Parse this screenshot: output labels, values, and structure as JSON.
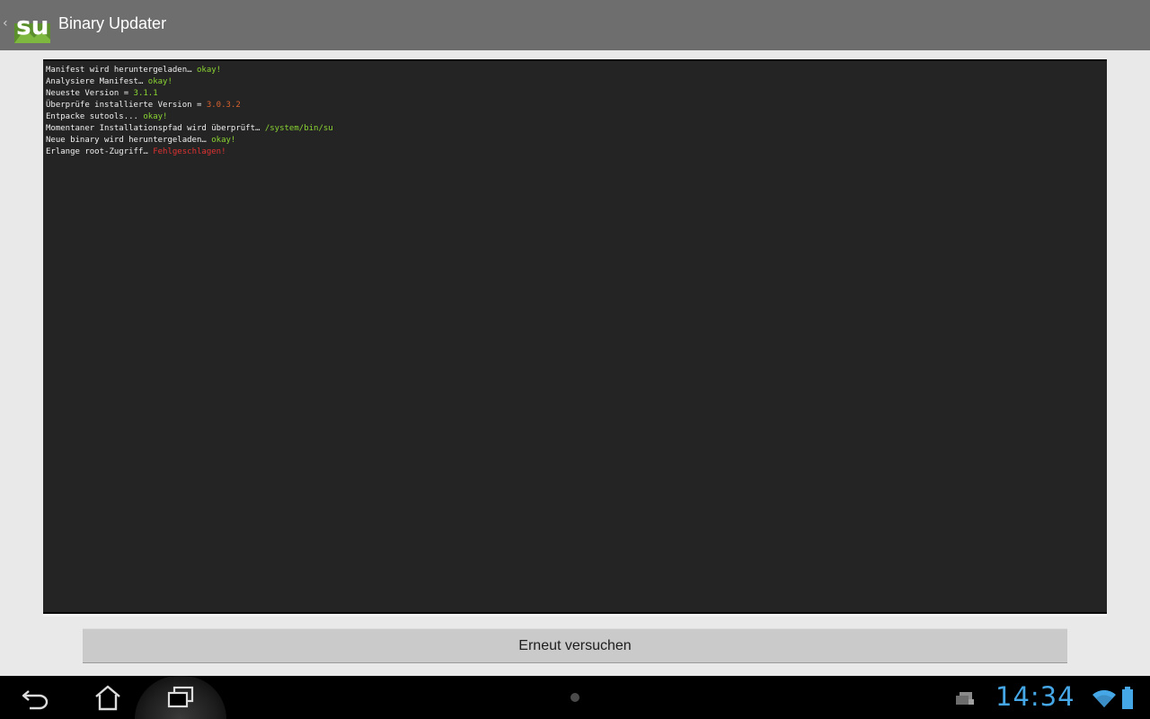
{
  "action_bar": {
    "title": "Binary Updater",
    "icon_text": "su",
    "up_caret": "‹"
  },
  "console": {
    "lines": [
      {
        "text": "Manifest wird heruntergeladen… ",
        "status": "okay!",
        "status_color": "#8bd432"
      },
      {
        "text": "Analysiere Manifest… ",
        "status": "okay!",
        "status_color": "#8bd432"
      },
      {
        "text": "Neueste Version = ",
        "status": "3.1.1",
        "status_color": "#8bd432"
      },
      {
        "text": "Überprüfe installierte Version = ",
        "status": "3.0.3.2",
        "status_color": "#d8622e"
      },
      {
        "text": "Entpacke sutools... ",
        "status": "okay!",
        "status_color": "#8bd432"
      },
      {
        "text": "Momentaner Installationspfad wird überprüft… ",
        "status": "/system/bin/su",
        "status_color": "#8bd432"
      },
      {
        "text": "Neue binary wird heruntergeladen… ",
        "status": "okay!",
        "status_color": "#8bd432"
      },
      {
        "text": "Erlange root-Zugriff… ",
        "status": "Fehlgeschlagen!",
        "status_color": "#e03232"
      }
    ]
  },
  "retry_button": {
    "label": "Erneut versuchen"
  },
  "system_bar": {
    "clock": "14:34",
    "accent": "#46a7e6"
  }
}
